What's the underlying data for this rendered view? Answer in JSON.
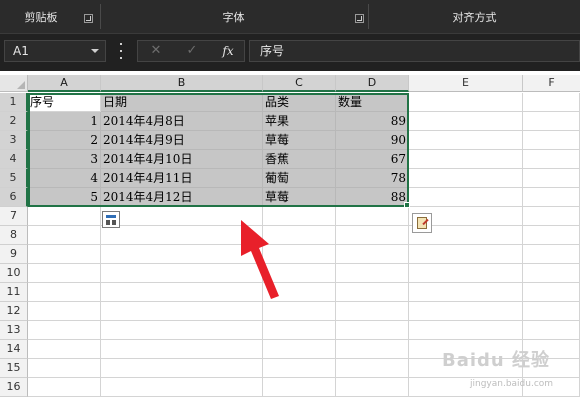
{
  "ribbon": {
    "groups": [
      "剪贴板",
      "字体",
      "对齐方式"
    ]
  },
  "formula_bar": {
    "name_box": "A1",
    "cancel_icon": "✕",
    "confirm_icon": "✓",
    "function_icon": "fx",
    "content": "序号"
  },
  "columns": [
    "A",
    "B",
    "C",
    "D",
    "E",
    "F"
  ],
  "rows": [
    "1",
    "2",
    "3",
    "4",
    "5",
    "6",
    "7",
    "8",
    "9",
    "10",
    "11",
    "12",
    "13",
    "14",
    "15",
    "16"
  ],
  "table": {
    "headers": [
      "序号",
      "日期",
      "品类",
      "数量"
    ],
    "rows": [
      [
        "1",
        "2014年4月8日",
        "苹果",
        "89"
      ],
      [
        "2",
        "2014年4月9日",
        "草莓",
        "90"
      ],
      [
        "3",
        "2014年4月10日",
        "香蕉",
        "67"
      ],
      [
        "4",
        "2014年4月11日",
        "葡萄",
        "78"
      ],
      [
        "5",
        "2014年4月12日",
        "草莓",
        "88"
      ]
    ]
  },
  "watermark": {
    "logo": "Baidu 经验",
    "url": "jingyan.baidu.com"
  },
  "colors": {
    "selection_border": "#217346",
    "arrow": "#e8202a",
    "selection_fill": "#c6c6c6"
  }
}
